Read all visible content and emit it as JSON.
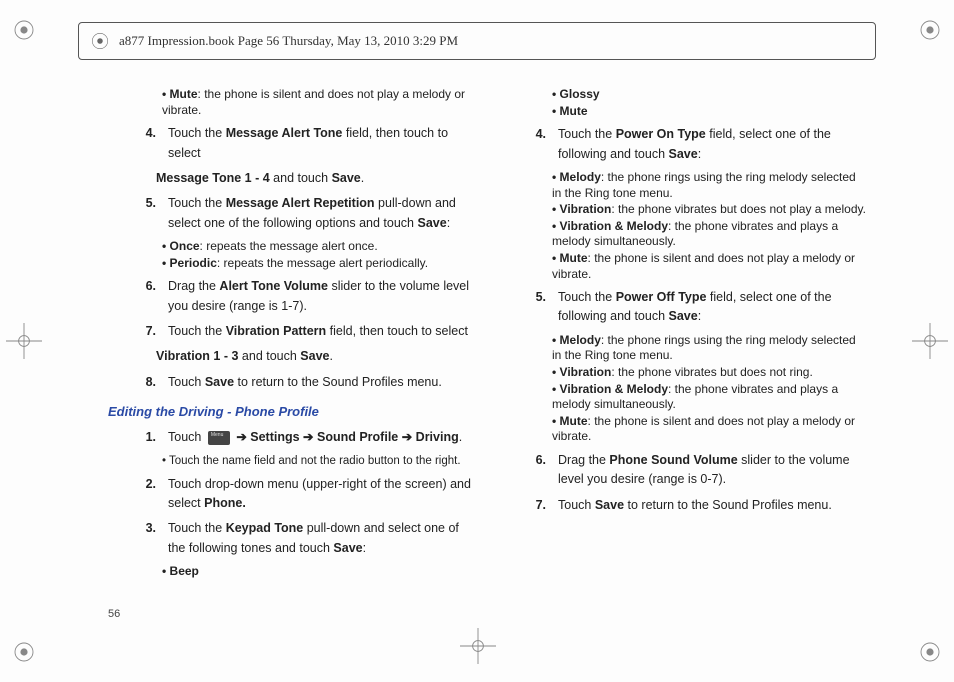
{
  "header": "a877 Impression.book  Page 56  Thursday, May 13, 2010  3:29 PM",
  "page_number": "56",
  "left": {
    "b_mute": "• Mute: the phone is silent and does not play a melody or vibrate.",
    "s4_a": "Touch the ",
    "s4_b": "Message Alert Tone",
    "s4_c": " field, then touch to select ",
    "s4_d": "Message Tone 1 - 4",
    "s4_e": " and touch ",
    "s4_f": "Save",
    "s4_g": ".",
    "s5_a": "Touch the ",
    "s5_b": "Message Alert Repetition",
    "s5_c": " pull-down and select one of the following options and touch ",
    "s5_d": "Save",
    "s5_e": ":",
    "b_once": "• Once: repeats the message alert once.",
    "b_per": "• Periodic: repeats the message alert periodically.",
    "s6_a": "Drag the ",
    "s6_b": "Alert Tone Volume",
    "s6_c": " slider to the volume level you desire (range is 1-7).",
    "s7_a": "Touch the ",
    "s7_b": "Vibration Pattern",
    "s7_c": " field, then touch to select ",
    "s7_d": "Vibration 1 - 3",
    "s7_e": " and touch ",
    "s7_f": "Save",
    "s7_g": ".",
    "s8_a": "Touch ",
    "s8_b": "Save",
    "s8_c": " to return to the Sound Profiles menu.",
    "heading": "Editing the Driving - Phone Profile",
    "d1_a": "Touch  ",
    "d1_b": " ➔ Settings ➔ Sound Profile ➔ Driving",
    "d1_c": ".",
    "d1_bullet": "•  Touch the name field and not the radio button to the right.",
    "d2_a": "Touch drop-down menu (upper-right of the screen) and select ",
    "d2_b": "Phone.",
    "d3_a": "Touch the ",
    "d3_b": "Keypad Tone",
    "d3_c": " pull-down and select one of the following tones and touch ",
    "d3_d": "Save",
    "d3_e": ":",
    "b_beep": "• Beep"
  },
  "right": {
    "b_glossy": "• Glossy",
    "b_mute": "• Mute",
    "s4_a": "Touch the ",
    "s4_b": "Power On Type",
    "s4_c": " field, select one of the following and touch ",
    "s4_d": "Save",
    "s4_e": ":",
    "on_mel": "• Melody: the phone rings using the ring melody selected in the Ring tone menu.",
    "on_vib": "• Vibration: the phone vibrates but does not play a melody.",
    "on_vm": "• Vibration & Melody: the phone vibrates and plays a melody simultaneously.",
    "on_mute": "• Mute: the phone is silent and does not play a melody or vibrate.",
    "s5_a": "Touch the ",
    "s5_b": "Power Off Type",
    "s5_c": " field, select one of the following and touch ",
    "s5_d": "Save",
    "s5_e": ":",
    "off_mel": "• Melody: the phone rings using the ring melody selected in the Ring tone menu.",
    "off_vib": "• Vibration: the phone vibrates but does not ring.",
    "off_vm": "• Vibration & Melody: the phone vibrates and plays a melody simultaneously.",
    "off_mute": "• Mute: the phone is silent and does not play a melody or vibrate.",
    "s6_a": "Drag the ",
    "s6_b": "Phone Sound Volume",
    "s6_c": " slider to the volume level you desire (range is 0-7).",
    "s7_a": "Touch ",
    "s7_b": "Save",
    "s7_c": " to return to the Sound Profiles menu."
  }
}
